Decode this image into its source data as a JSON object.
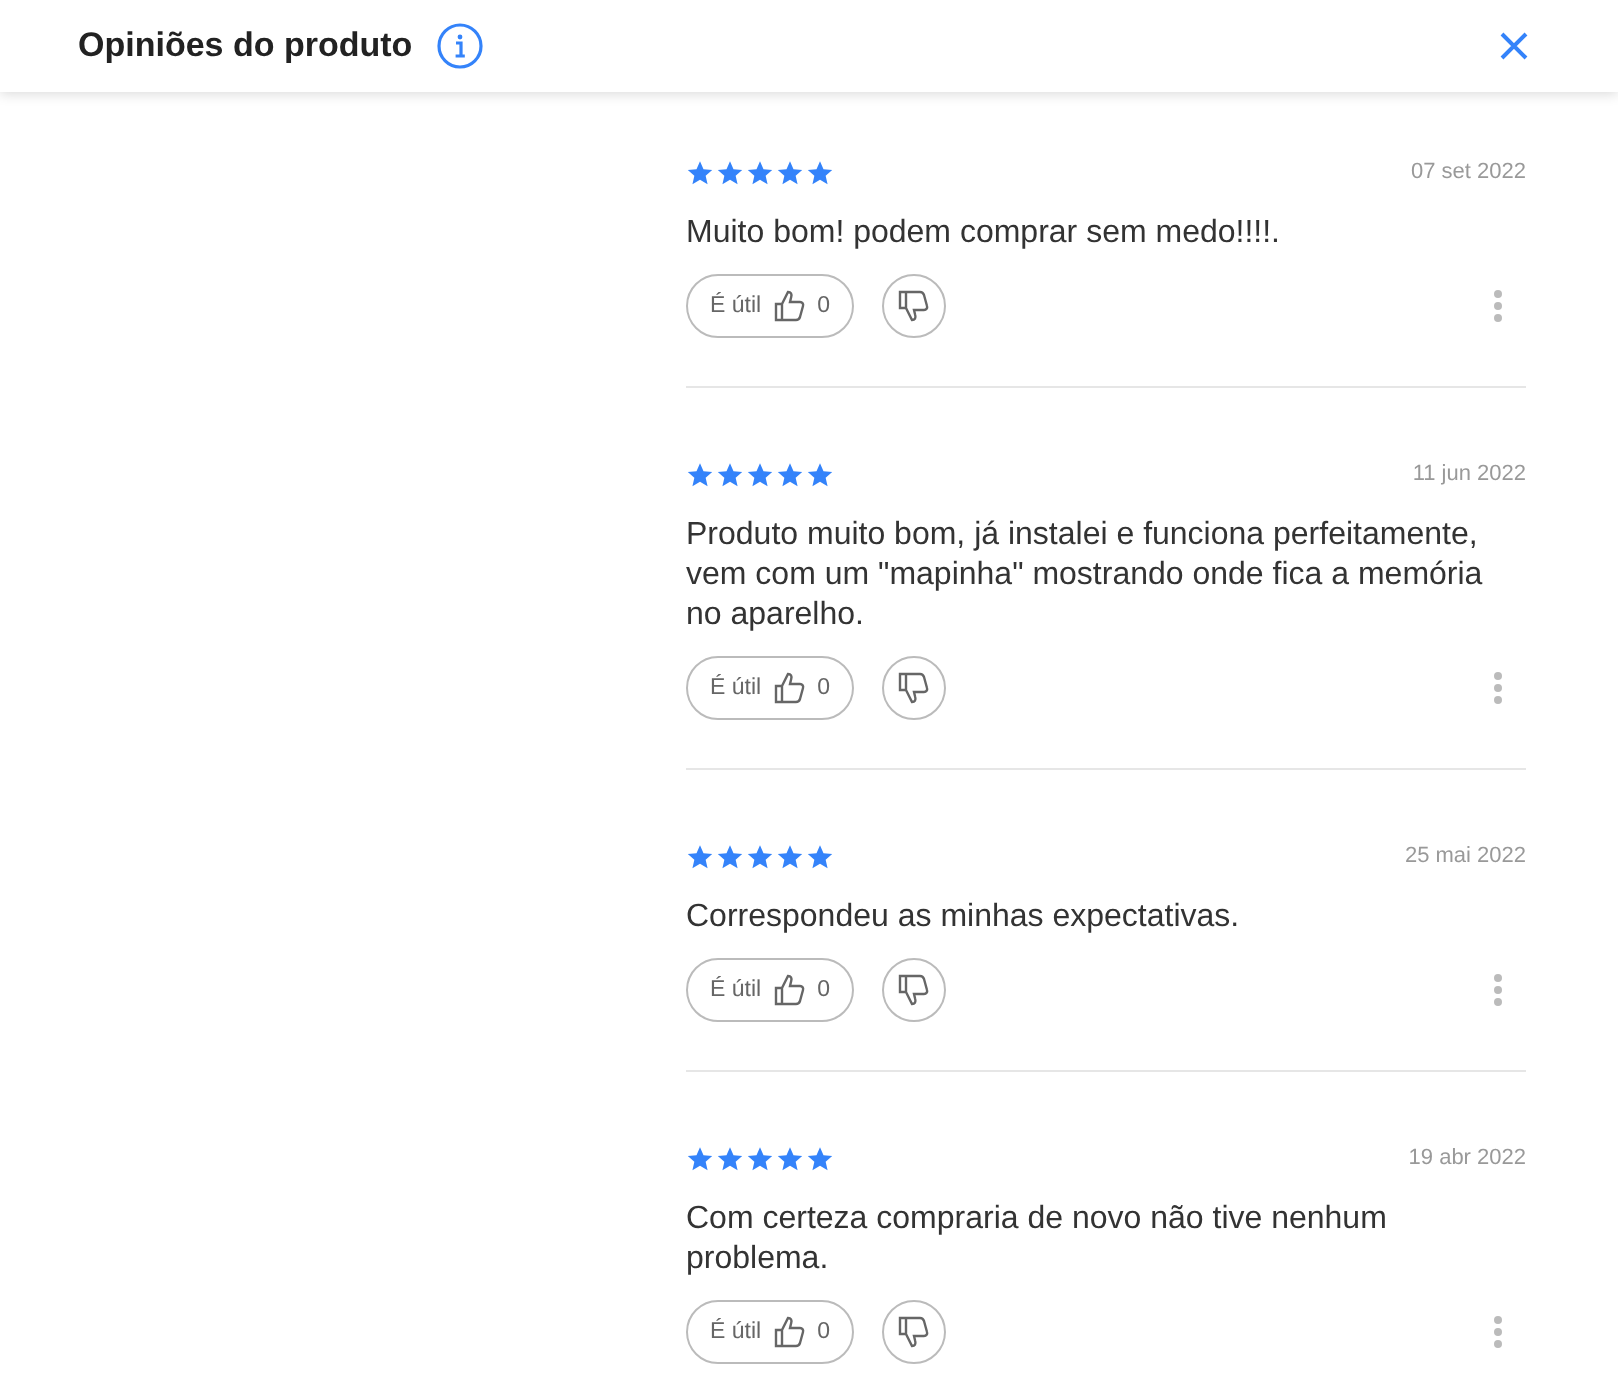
{
  "header": {
    "title": "Opiniões do produto"
  },
  "reviews": [
    {
      "stars": 5,
      "date": "07 set 2022",
      "text": "Muito bom! podem comprar sem medo!!!!.",
      "helpful_label": "É útil",
      "helpful_count": "0"
    },
    {
      "stars": 5,
      "date": "11 jun 2022",
      "text": "Produto muito bom, já instalei e funciona perfeitamente, vem com um \"mapinha\" mostrando onde fica a memória no aparelho.",
      "helpful_label": "É útil",
      "helpful_count": "0"
    },
    {
      "stars": 5,
      "date": "25 mai 2022",
      "text": "Correspondeu as minhas expectativas.",
      "helpful_label": "É útil",
      "helpful_count": "0"
    },
    {
      "stars": 5,
      "date": "19 abr 2022",
      "text": "Com certeza compraria de novo não tive nenhum problema.",
      "helpful_label": "É útil",
      "helpful_count": "0"
    }
  ]
}
